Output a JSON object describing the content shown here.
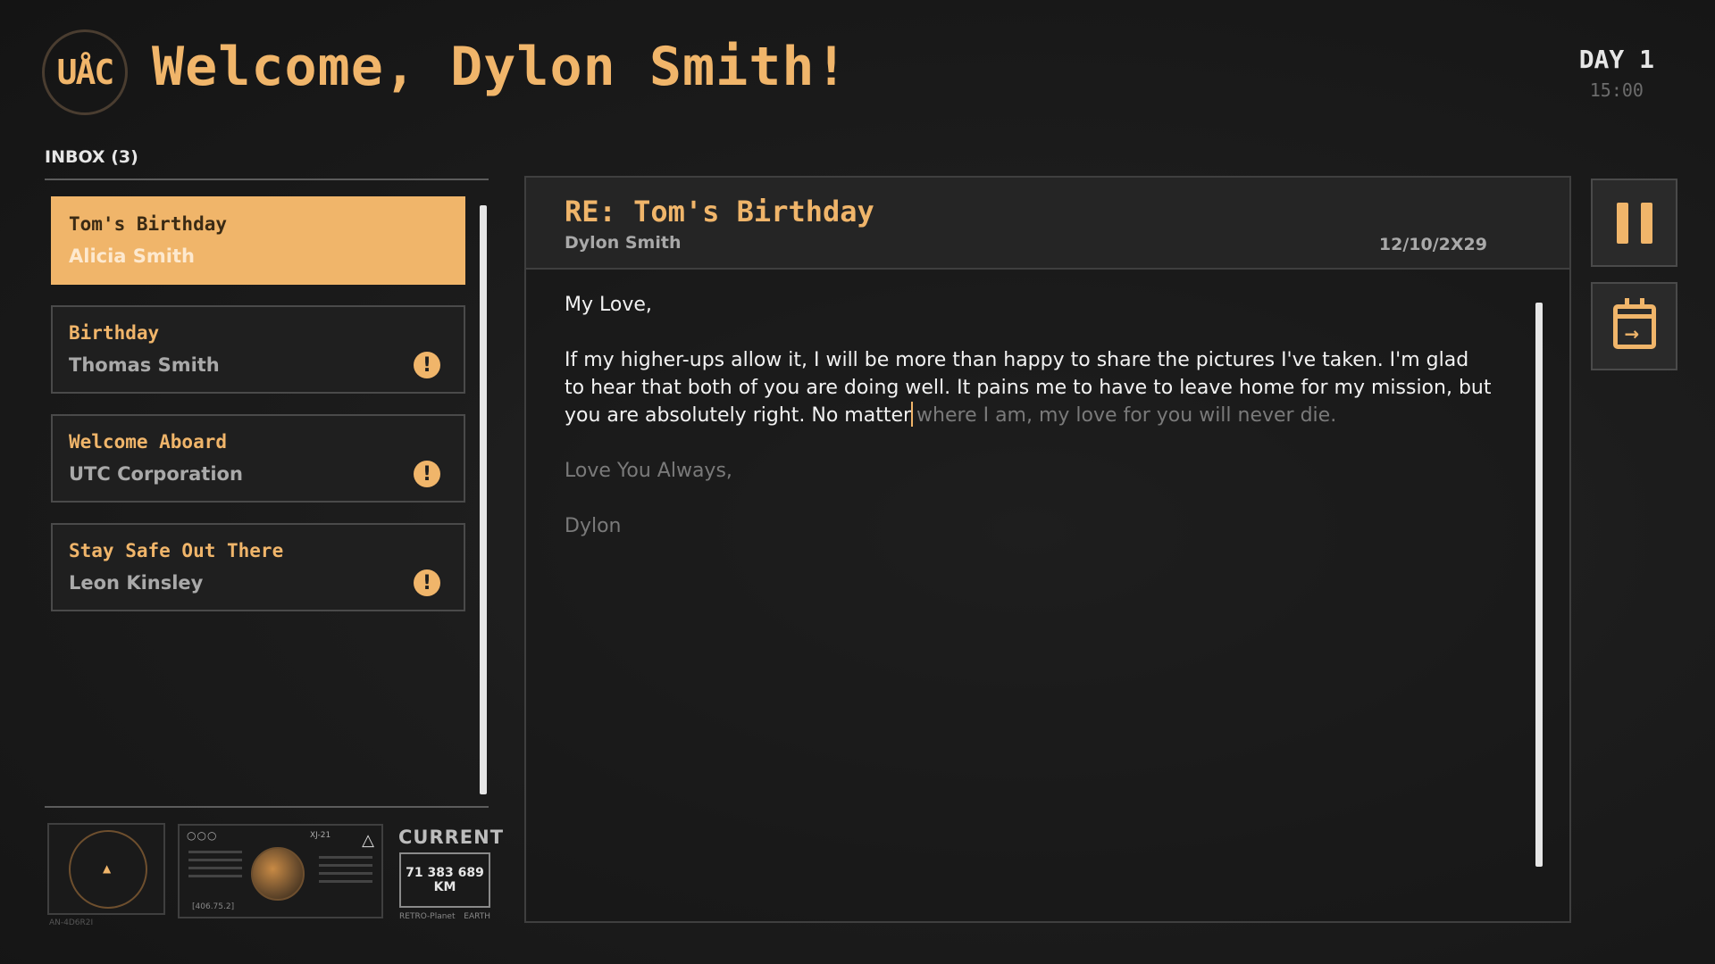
{
  "header": {
    "logo_text": "UÅC",
    "welcome": "Welcome, Dylon Smith!",
    "day": "DAY 1",
    "time": "15:00"
  },
  "inbox": {
    "label": "INBOX (3)",
    "items": [
      {
        "subject": "Tom's Birthday",
        "from": "Alicia Smith",
        "selected": true,
        "unread": false
      },
      {
        "subject": "Birthday",
        "from": "Thomas Smith",
        "selected": false,
        "unread": true
      },
      {
        "subject": "Welcome Aboard",
        "from": "UTC Corporation",
        "selected": false,
        "unread": true
      },
      {
        "subject": "Stay Safe Out There",
        "from": "Leon Kinsley",
        "selected": false,
        "unread": true
      }
    ],
    "alert_glyph": "!"
  },
  "widgets": {
    "current_label": "CURRENT",
    "distance_line1": "71 383 689",
    "distance_line2": "KM",
    "distance_caption_left": "RETRO-Planet",
    "distance_caption_right": "EARTH",
    "map_tag": "XJ-21",
    "map_coord": "[406.75.2]",
    "radar_caption": "AN-4D6R2I"
  },
  "email": {
    "subject": "RE: Tom's Birthday",
    "from": "Dylon Smith",
    "date": "12/10/2X29",
    "greeting": "My Love,",
    "body_typed": "If my higher-ups allow it, I will be more than happy to share the pictures I've taken. I'm glad to hear that both of you are doing well. It pains me to have to leave home for my mission, but you are absolutely right. No matter",
    "body_pending": "where I am, my love for you will never die.",
    "closing": "Love You Always,",
    "signature": "Dylon"
  },
  "controls": {
    "pause_icon": "pause-icon",
    "calendar_icon": "calendar-next-icon"
  },
  "colors": {
    "accent": "#f0b56a",
    "background": "#1c1c1c"
  }
}
